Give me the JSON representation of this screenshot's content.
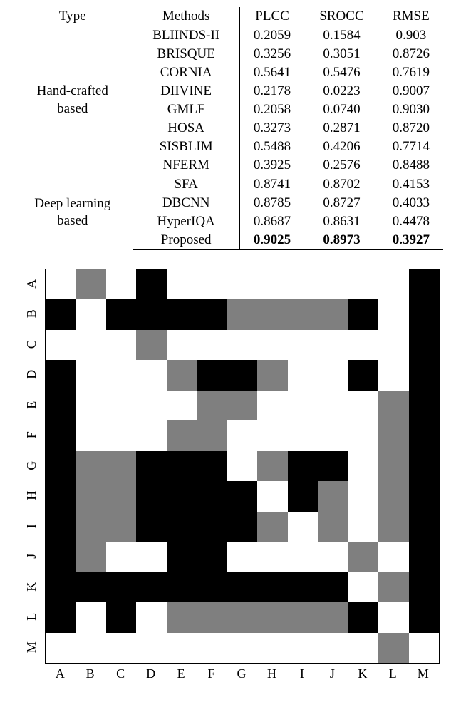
{
  "table": {
    "headers": [
      "Type",
      "Methods",
      "PLCC",
      "SROCC",
      "RMSE"
    ],
    "groups": [
      {
        "type_lines": [
          "Hand-crafted",
          "based"
        ],
        "rows": [
          {
            "method": "BLIINDS-II",
            "plcc": "0.2059",
            "srocc": "0.1584",
            "rmse": "0.903"
          },
          {
            "method": "BRISQUE",
            "plcc": "0.3256",
            "srocc": "0.3051",
            "rmse": "0.8726"
          },
          {
            "method": "CORNIA",
            "plcc": "0.5641",
            "srocc": "0.5476",
            "rmse": "0.7619"
          },
          {
            "method": "DIIVINE",
            "plcc": "0.2178",
            "srocc": "0.0223",
            "rmse": "0.9007"
          },
          {
            "method": "GMLF",
            "plcc": "0.2058",
            "srocc": "0.0740",
            "rmse": "0.9030"
          },
          {
            "method": "HOSA",
            "plcc": "0.3273",
            "srocc": "0.2871",
            "rmse": "0.8720"
          },
          {
            "method": "SISBLIM",
            "plcc": "0.5488",
            "srocc": "0.4206",
            "rmse": "0.7714"
          },
          {
            "method": "NFERM",
            "plcc": "0.3925",
            "srocc": "0.2576",
            "rmse": "0.8488"
          }
        ]
      },
      {
        "type_lines": [
          "Deep learning",
          "based"
        ],
        "rows": [
          {
            "method": "SFA",
            "plcc": "0.8741",
            "srocc": "0.8702",
            "rmse": "0.4153"
          },
          {
            "method": "DBCNN",
            "plcc": "0.8785",
            "srocc": "0.8727",
            "rmse": "0.4033"
          },
          {
            "method": "HyperIQA",
            "plcc": "0.8687",
            "srocc": "0.8631",
            "rmse": "0.4478"
          },
          {
            "method": "Proposed",
            "plcc": "0.9025",
            "srocc": "0.8973",
            "rmse": "0.3927",
            "bold": true
          }
        ]
      }
    ]
  },
  "chart_data": {
    "type": "heatmap",
    "x_categories": [
      "A",
      "B",
      "C",
      "D",
      "E",
      "F",
      "G",
      "H",
      "I",
      "J",
      "K",
      "L",
      "M"
    ],
    "y_categories": [
      "A",
      "B",
      "C",
      "D",
      "E",
      "F",
      "G",
      "H",
      "I",
      "J",
      "K",
      "L",
      "M"
    ],
    "value_labels": {
      "0": "white",
      "1": "gray",
      "2": "black"
    },
    "matrix": [
      [
        0,
        1,
        0,
        2,
        0,
        0,
        0,
        0,
        0,
        0,
        0,
        0,
        2
      ],
      [
        2,
        0,
        2,
        2,
        2,
        2,
        1,
        1,
        1,
        1,
        2,
        0,
        2
      ],
      [
        0,
        0,
        0,
        1,
        0,
        0,
        0,
        0,
        0,
        0,
        0,
        0,
        2
      ],
      [
        2,
        0,
        0,
        0,
        1,
        2,
        2,
        1,
        0,
        0,
        2,
        0,
        2
      ],
      [
        2,
        0,
        0,
        0,
        0,
        1,
        1,
        0,
        0,
        0,
        0,
        1,
        2
      ],
      [
        2,
        0,
        0,
        0,
        1,
        1,
        0,
        0,
        0,
        0,
        0,
        1,
        2
      ],
      [
        2,
        1,
        1,
        2,
        2,
        2,
        0,
        1,
        2,
        2,
        0,
        1,
        2
      ],
      [
        2,
        1,
        1,
        2,
        2,
        2,
        2,
        0,
        2,
        1,
        0,
        1,
        2
      ],
      [
        2,
        1,
        1,
        2,
        2,
        2,
        2,
        1,
        0,
        1,
        0,
        1,
        2
      ],
      [
        2,
        1,
        0,
        0,
        2,
        2,
        0,
        0,
        0,
        0,
        1,
        0,
        2
      ],
      [
        2,
        2,
        2,
        2,
        2,
        2,
        2,
        2,
        2,
        2,
        0,
        1,
        2
      ],
      [
        2,
        0,
        2,
        0,
        1,
        1,
        1,
        1,
        1,
        1,
        2,
        0,
        2
      ],
      [
        0,
        0,
        0,
        0,
        0,
        0,
        0,
        0,
        0,
        0,
        0,
        1,
        0
      ]
    ]
  }
}
